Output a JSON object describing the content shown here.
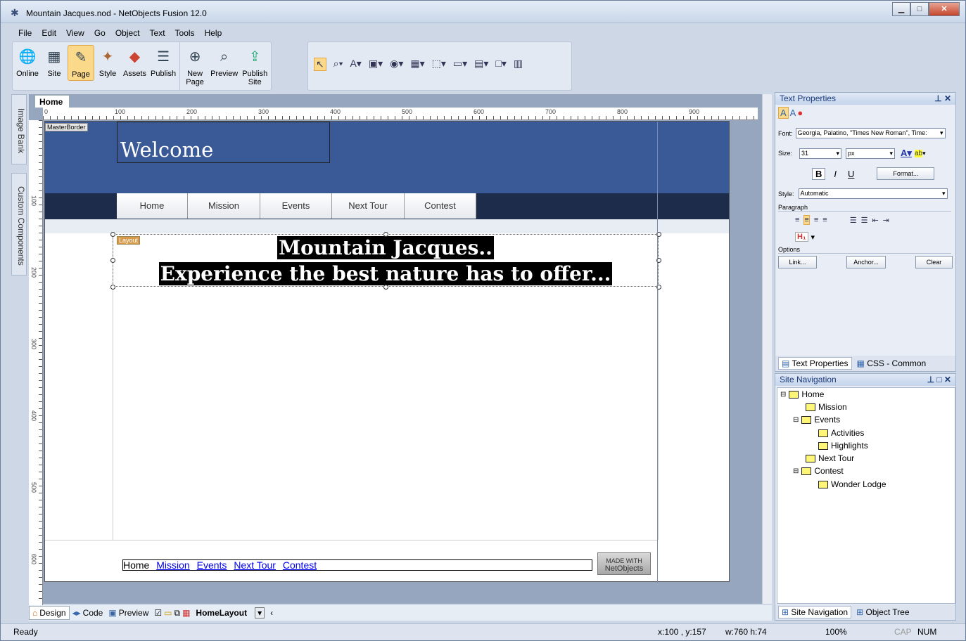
{
  "window": {
    "title": "Mountain Jacques.nod - NetObjects Fusion 12.0"
  },
  "menu": [
    "File",
    "Edit",
    "View",
    "Go",
    "Object",
    "Text",
    "Tools",
    "Help"
  ],
  "toolbar": {
    "buttons": [
      {
        "label": "Online",
        "icon": "globe-icon"
      },
      {
        "label": "Site",
        "icon": "sitemap-icon"
      },
      {
        "label": "Page",
        "icon": "page-edit-icon",
        "active": true
      },
      {
        "label": "Style",
        "icon": "style-icon"
      },
      {
        "label": "Assets",
        "icon": "assets-icon"
      },
      {
        "label": "Publish",
        "icon": "publish-icon"
      }
    ],
    "buttons2": [
      {
        "label": "New\nPage",
        "icon": "new-page-icon"
      },
      {
        "label": "Preview",
        "icon": "preview-icon"
      },
      {
        "label": "Publish\nSite",
        "icon": "publish-site-icon"
      }
    ]
  },
  "left_dock": {
    "image_bank": "Image Bank",
    "custom_components": "Custom Components"
  },
  "editor": {
    "tab": "Home",
    "ruler_labels": [
      "0",
      "100",
      "200",
      "300",
      "400",
      "500",
      "600",
      "700",
      "800",
      "900"
    ],
    "vruler_labels": [
      "100",
      "200",
      "300",
      "400",
      "500",
      "600"
    ],
    "masterborder_tag": "MasterBorder",
    "layout_tag": "Layout",
    "banner_text": "Welcome",
    "nav_buttons": [
      "Home",
      "Mission",
      "Events",
      "Next Tour",
      "Contest"
    ],
    "heading_line1": "Mountain Jacques..",
    "heading_line2": "Experience the best nature has to offer...",
    "footer_links": [
      "Home",
      "Mission",
      "Events",
      "Next Tour",
      "Contest"
    ],
    "badge_line1": "MADE WITH",
    "badge_line2": "NetObjects"
  },
  "view_tabs": {
    "design": "Design",
    "code": "Code",
    "preview": "Preview",
    "layout_select": "HomeLayout"
  },
  "text_properties": {
    "title": "Text Properties",
    "font_label": "Font:",
    "font_value": "Georgia, Palatino, \"Times New Roman\", Time:",
    "size_label": "Size:",
    "size_value": "31",
    "unit_value": "px",
    "format_button": "Format...",
    "style_label": "Style:",
    "style_value": "Automatic",
    "paragraph_label": "Paragraph",
    "options_label": "Options",
    "link_button": "Link...",
    "anchor_button": "Anchor...",
    "clear_button": "Clear",
    "tab_text": "Text Properties",
    "tab_css": "CSS - Common"
  },
  "site_navigation": {
    "title": "Site Navigation",
    "tree": [
      "Home",
      "Mission",
      "Events",
      "Activities",
      "Highlights",
      "Next Tour",
      "Contest",
      "Wonder Lodge"
    ],
    "tab_nav": "Site Navigation",
    "tab_tree": "Object Tree"
  },
  "status": {
    "ready": "Ready",
    "coords": "x:100 , y:157",
    "size": "w:760 h:74",
    "zoom": "100%",
    "cap": "CAP",
    "num": "NUM"
  }
}
